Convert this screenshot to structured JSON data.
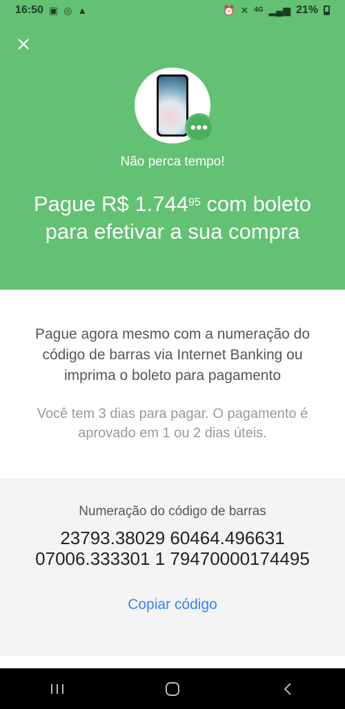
{
  "status_bar": {
    "time": "16:50",
    "network": "4G",
    "battery": "21%"
  },
  "header": {
    "subtitle": "Não perca tempo!",
    "headline_prefix": "Pague R$ 1.744",
    "headline_cents": "95",
    "headline_suffix": " com boleto para efetivar a sua compra"
  },
  "info": {
    "main_text": "Pague agora mesmo com a numeração do código de barras via Internet Banking ou imprima o boleto para pagamento",
    "sub_text": "Você tem 3 dias para pagar. O pagamento é aprovado em 1 ou 2 dias úteis."
  },
  "barcode": {
    "label": "Numeração do código de barras",
    "line1": "23793.38029 60464.496631",
    "line2": "07006.333301 1 79470000174495",
    "copy_label": "Copiar código"
  },
  "colors": {
    "brand_green": "#62c173",
    "link_blue": "#3483fa"
  }
}
